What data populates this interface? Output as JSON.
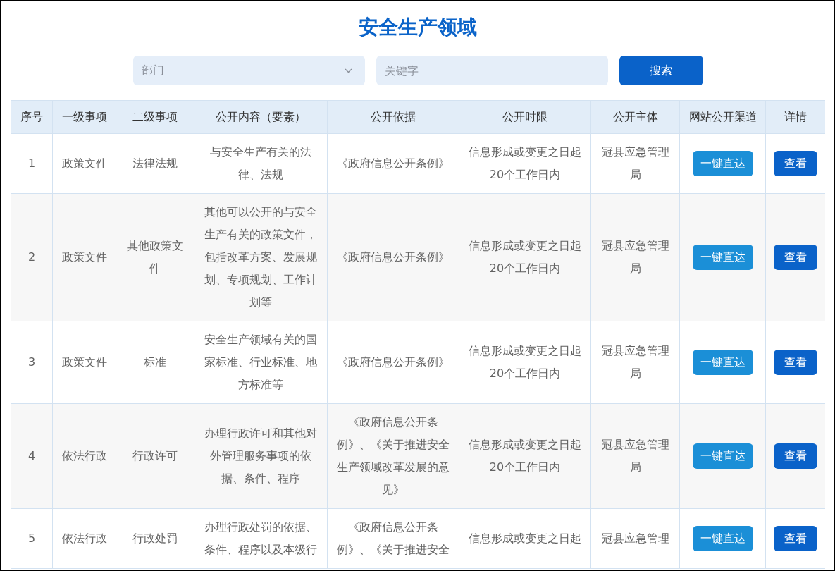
{
  "title": "安全生产领域",
  "search": {
    "department": {
      "placeholder": "部门"
    },
    "keyword": {
      "placeholder": "关键字"
    },
    "button": "搜索"
  },
  "table": {
    "columns": [
      "序号",
      "一级事项",
      "二级事项",
      "公开内容（要素）",
      "公开依据",
      "公开时限",
      "公开主体",
      "网站公开渠道",
      "详情"
    ],
    "rows": [
      {
        "no": "1",
        "level1": "政策文件",
        "level2": "法律法规",
        "content": "与安全生产有关的法律、法规",
        "basis": "《政府信息公开条例》",
        "time_limit": "信息形成或变更之日起20个工作日内",
        "subject": "冠县应急管理局",
        "channel_button": "一键直达",
        "detail_button": "查看"
      },
      {
        "no": "2",
        "level1": "政策文件",
        "level2": "其他政策文件",
        "content": "其他可以公开的与安全生产有关的政策文件，包括改革方案、发展规划、专项规划、工作计划等",
        "basis": "《政府信息公开条例》",
        "time_limit": "信息形成或变更之日起20个工作日内",
        "subject": "冠县应急管理局",
        "channel_button": "一键直达",
        "detail_button": "查看"
      },
      {
        "no": "3",
        "level1": "政策文件",
        "level2": "标准",
        "content": "安全生产领域有关的国家标准、行业标准、地方标准等",
        "basis": "《政府信息公开条例》",
        "time_limit": "信息形成或变更之日起20个工作日内",
        "subject": "冠县应急管理局",
        "channel_button": "一键直达",
        "detail_button": "查看"
      },
      {
        "no": "4",
        "level1": "依法行政",
        "level2": "行政许可",
        "content": "办理行政许可和其他对外管理服务事项的依据、条件、程序",
        "basis": "《政府信息公开条例》、《关于推进安全生产领域改革发展的意见》",
        "time_limit": "信息形成或变更之日起20个工作日内",
        "subject": "冠县应急管理局",
        "channel_button": "一键直达",
        "detail_button": "查看"
      },
      {
        "no": "5",
        "level1": "依法行政",
        "level2": "行政处罚",
        "content": "办理行政处罚的依据、条件、程序以及本级行",
        "basis": "《政府信息公开条例》、《关于推进安全",
        "time_limit": "信息形成或变更之日起",
        "subject": "冠县应急管理",
        "channel_button": "一键直达",
        "detail_button": "查看"
      }
    ]
  }
}
